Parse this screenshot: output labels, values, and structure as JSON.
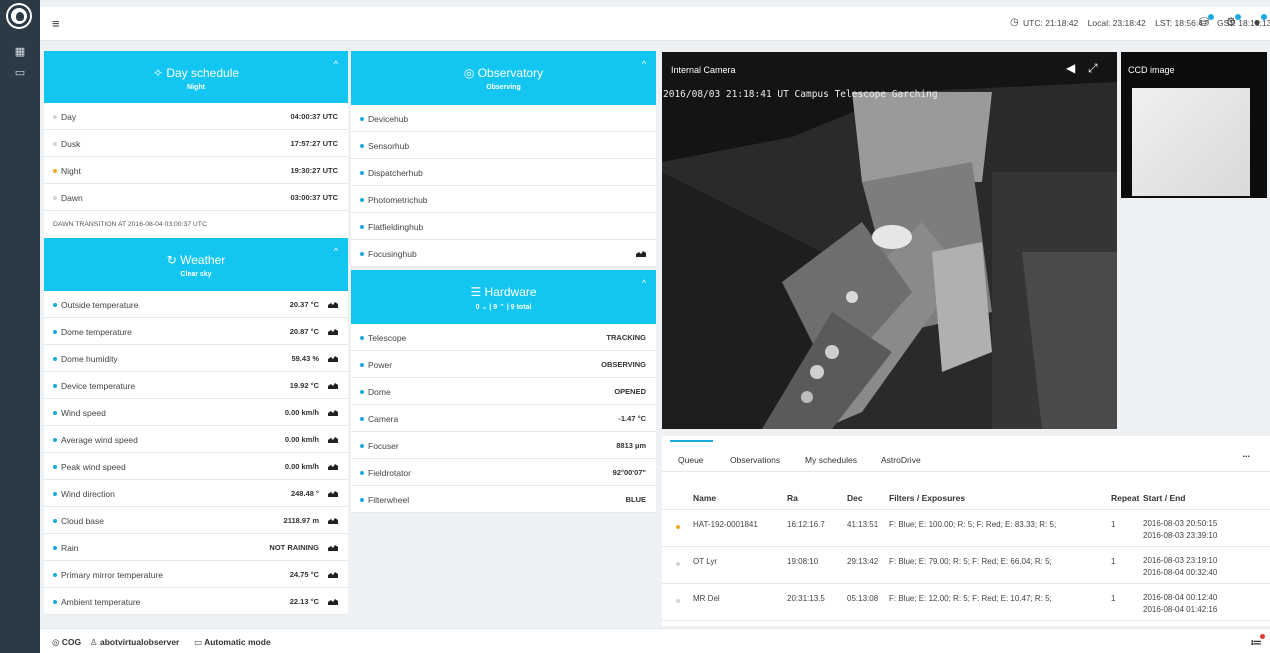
{
  "topbar": {
    "utc": "UTC: 21:18:42",
    "local": "Local: 23:18:42",
    "lst": "LST: 18:56:47",
    "gst": "GST: 18:10:13"
  },
  "day_schedule": {
    "title": "Day schedule",
    "subtitle": "Night",
    "rows": [
      {
        "label": "Day",
        "value": "04:00:37 UTC"
      },
      {
        "label": "Dusk",
        "value": "17:57:27 UTC"
      },
      {
        "label": "Night",
        "value": "19:30:27 UTC"
      },
      {
        "label": "Dawn",
        "value": "03:00:37 UTC"
      }
    ],
    "transition": "DAWN TRANSITION AT 2016-08-04 03:00:37 UTC"
  },
  "weather": {
    "title": "Weather",
    "subtitle": "Clear sky",
    "rows": [
      {
        "label": "Outside temperature",
        "value": "20.37 °C"
      },
      {
        "label": "Dome temperature",
        "value": "20.87 °C"
      },
      {
        "label": "Dome humidity",
        "value": "59.43 %"
      },
      {
        "label": "Device temperature",
        "value": "19.92 °C"
      },
      {
        "label": "Wind speed",
        "value": "0.00 km/h"
      },
      {
        "label": "Average wind speed",
        "value": "0.00 km/h"
      },
      {
        "label": "Peak wind speed",
        "value": "0.00 km/h"
      },
      {
        "label": "Wind direction",
        "value": "248.48 °"
      },
      {
        "label": "Cloud base",
        "value": "2118.97 m"
      },
      {
        "label": "Rain",
        "value": "NOT RAINING"
      },
      {
        "label": "Primary mirror temperature",
        "value": "24.75 °C"
      },
      {
        "label": "Ambient temperature",
        "value": "22.13 °C"
      }
    ]
  },
  "observatory": {
    "title": "Observatory",
    "subtitle": "Observing",
    "rows": [
      {
        "label": "Devicehub"
      },
      {
        "label": "Sensorhub"
      },
      {
        "label": "Dispatcherhub"
      },
      {
        "label": "Photometrichub"
      },
      {
        "label": "Flatfieldinghub"
      },
      {
        "label": "Focusinghub"
      }
    ]
  },
  "hardware": {
    "title": "Hardware",
    "subtitle": "0 ⌄ | 9 ⌃ | 9 total",
    "rows": [
      {
        "label": "Telescope",
        "value": "TRACKING"
      },
      {
        "label": "Power",
        "value": "OBSERVING"
      },
      {
        "label": "Dome",
        "value": "OPENED"
      },
      {
        "label": "Camera",
        "value": "-1.47 °C"
      },
      {
        "label": "Focuser",
        "value": "8813 µm"
      },
      {
        "label": "Fieldrotator",
        "value": "92°00'07\""
      },
      {
        "label": "Filterwheel",
        "value": "BLUE"
      }
    ]
  },
  "camera": {
    "title": "Internal Camera",
    "stamp": "2016/08/03 21:18:41 UT  Campus Telescope Garching"
  },
  "ccd": {
    "title": "CCD image"
  },
  "queue": {
    "tabs": [
      "Queue",
      "Observations",
      "My schedules",
      "AstroDrive"
    ],
    "more": "...",
    "headers": [
      "Name",
      "Ra",
      "Dec",
      "Filters / Exposures",
      "Repeat",
      "Start / End"
    ],
    "rows": [
      {
        "name": "HAT-192-0001841",
        "ra": "16:12:16.7",
        "dec": "41:13:51",
        "filters": "F: Blue; E: 100.00; R: 5; F: Red; E: 83.33; R: 5;",
        "repeat": "1",
        "start": "2016-08-03 20:50:15",
        "end": "2016-08-03 23:39:10"
      },
      {
        "name": "OT Lyr",
        "ra": "19:08:10",
        "dec": "29:13:42",
        "filters": "F: Blue; E: 79.00; R: 5; F: Red; E: 66.04; R: 5;",
        "repeat": "1",
        "start": "2016-08-03 23:19:10",
        "end": "2016-08-04 00:32:40"
      },
      {
        "name": "MR Del",
        "ra": "20:31:13.5",
        "dec": "05:13:08",
        "filters": "F: Blue; E: 12.00; R: 5; F: Red; E: 10.47; R: 5;",
        "repeat": "1",
        "start": "2016-08-04 00:12:40",
        "end": "2016-08-04 01:42:16"
      }
    ]
  },
  "bottombar": {
    "site": "COG",
    "user": "abotvirtualobserver",
    "mode": "Automatic mode"
  }
}
